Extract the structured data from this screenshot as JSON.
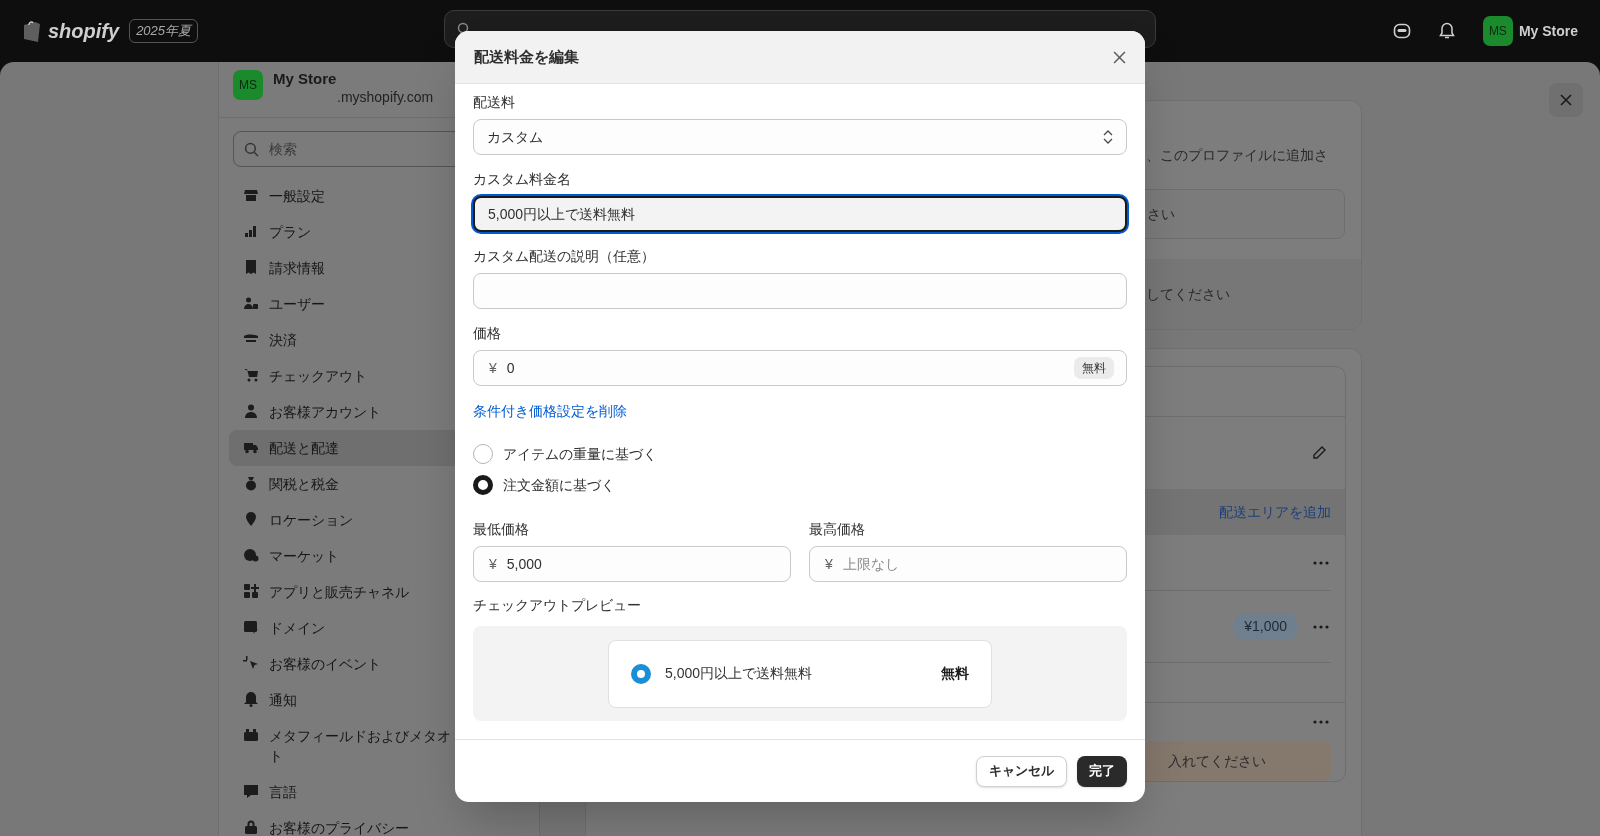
{
  "topbar": {
    "logo": "shopify",
    "edition_badge": "2025年夏",
    "avatar": "MS",
    "store_name": "My Store"
  },
  "sidebar": {
    "store": {
      "avatar": "MS",
      "name": "My Store",
      "domain": ".myshopify.com"
    },
    "search_placeholder": "検索",
    "items": [
      {
        "label": "一般設定",
        "selected": false
      },
      {
        "label": "プラン",
        "selected": false
      },
      {
        "label": "請求情報",
        "selected": false
      },
      {
        "label": "ユーザー",
        "selected": false
      },
      {
        "label": "決済",
        "selected": false
      },
      {
        "label": "チェックアウト",
        "selected": false
      },
      {
        "label": "お客様アカウント",
        "selected": false
      },
      {
        "label": "配送と配達",
        "selected": true
      },
      {
        "label": "関税と税金",
        "selected": false
      },
      {
        "label": "ロケーション",
        "selected": false
      },
      {
        "label": "マーケット",
        "selected": false
      },
      {
        "label": "アプリと販売チャネル",
        "selected": false
      },
      {
        "label": "ドメイン",
        "selected": false
      },
      {
        "label": "お客様のイベント",
        "selected": false
      },
      {
        "label": "通知",
        "selected": false
      },
      {
        "label": "メタフィールドおよびメタオト",
        "selected": false
      },
      {
        "label": "言語",
        "selected": false
      },
      {
        "label": "お客様のプライバシー",
        "selected": false
      }
    ]
  },
  "profile_card": {
    "description": "、このプロファイルに追加さ",
    "field_text": "さい",
    "footer_text": "してください"
  },
  "zones_card": {
    "add_zone_link": "配送エリアを追加",
    "rate_price": "¥1,000",
    "warning_text": "入れてください"
  },
  "modal": {
    "title": "配送料金を編集",
    "rate_type": {
      "label": "配送料",
      "value": "カスタム"
    },
    "rate_name": {
      "label": "カスタム料金名",
      "value": "5,000円以上で送料無料",
      "focused": true
    },
    "description": {
      "label": "カスタム配送の説明（任意）"
    },
    "price": {
      "label": "価格",
      "currency": "¥",
      "value": "0",
      "badge": "無料"
    },
    "remove_link": "条件付き価格設定を削除",
    "conditions": [
      {
        "label": "アイテムの重量に基づく",
        "selected": false
      },
      {
        "label": "注文金額に基づく",
        "selected": true
      }
    ],
    "min_price": {
      "label": "最低価格",
      "currency": "¥",
      "value": "5,000"
    },
    "max_price": {
      "label": "最高価格",
      "currency": "¥",
      "placeholder": "上限なし"
    },
    "preview": {
      "label": "チェックアウトプレビュー",
      "option": {
        "label": "5,000円以上で送料無料",
        "price": "無料",
        "selected": true
      }
    },
    "buttons": {
      "cancel": "キャンセル",
      "done": "完了"
    }
  }
}
